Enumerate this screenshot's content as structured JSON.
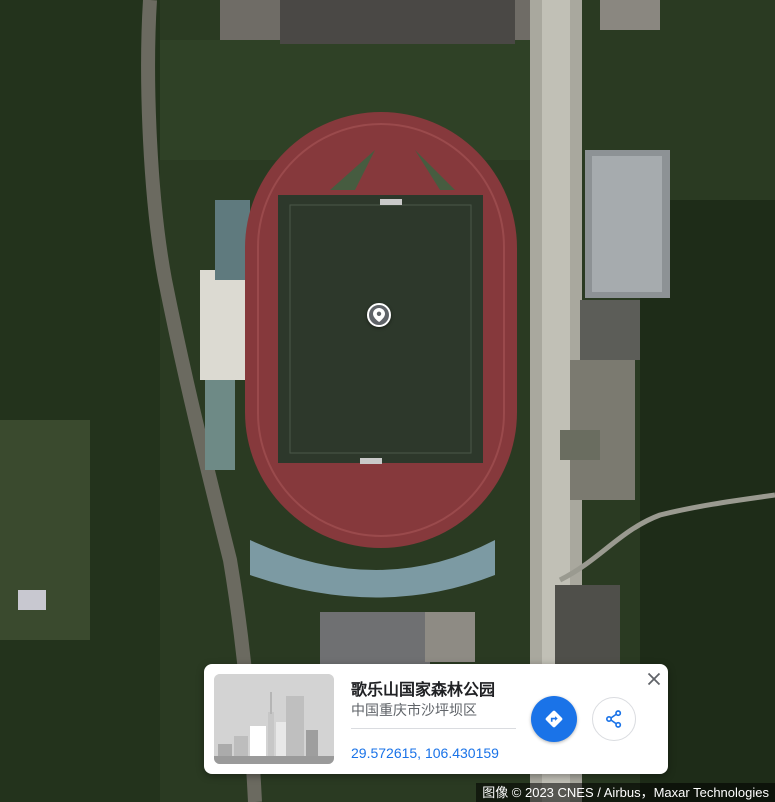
{
  "place": {
    "name": "歌乐山国家森林公园",
    "address": "中国重庆市沙坪坝区",
    "coordinates": "29.572615, 106.430159"
  },
  "attribution": "图像 © 2023 CNES / Airbus，Maxar Technologies",
  "icons": {
    "pin": "location-pin-icon",
    "directions": "directions-icon",
    "share": "share-icon",
    "close": "close-icon"
  },
  "colors": {
    "accent": "#1a73e8",
    "track": "#8b3a3c",
    "field": "#2f3a2c",
    "forest": "#26361f"
  }
}
